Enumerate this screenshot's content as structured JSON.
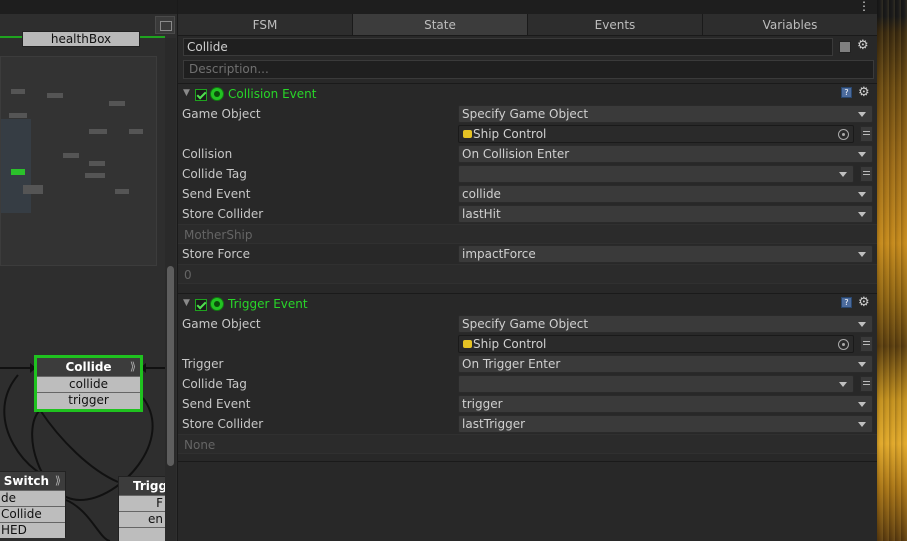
{
  "graph": {
    "nodes": {
      "healthbox": {
        "title": "healthBox"
      },
      "collide": {
        "title": "Collide",
        "events": [
          "collide",
          "trigger"
        ]
      },
      "switch": {
        "title": "g Switch",
        "events": [
          "de",
          "Collide",
          "HED"
        ]
      },
      "trigg": {
        "title": "Trigg",
        "events": [
          "F",
          "en"
        ]
      }
    }
  },
  "inspector": {
    "tabs": [
      "FSM",
      "State",
      "Events",
      "Variables"
    ],
    "active_tab": "State",
    "state_name": "Collide",
    "description_placeholder": "Description...",
    "actions": [
      {
        "title": "Collision Event",
        "rows": {
          "game_object_label": "Game Object",
          "game_object_value": "Specify Game Object",
          "object_field": "Ship Control",
          "collision_label": "Collision",
          "collision_value": "On Collision Enter",
          "collide_tag_label": "Collide Tag",
          "collide_tag_value": "",
          "send_event_label": "Send Event",
          "send_event_value": "collide",
          "store_collider_label": "Store Collider",
          "store_collider_value": "lastHit",
          "disabled_1": "MotherShip",
          "store_force_label": "Store Force",
          "store_force_value": "impactForce",
          "disabled_2": "0"
        }
      },
      {
        "title": "Trigger Event",
        "rows": {
          "game_object_label": "Game Object",
          "game_object_value": "Specify Game Object",
          "object_field": "Ship Control",
          "trigger_label": "Trigger",
          "trigger_value": "On Trigger Enter",
          "collide_tag_label": "Collide Tag",
          "collide_tag_value": "",
          "send_event_label": "Send Event",
          "send_event_value": "trigger",
          "store_collider_label": "Store Collider",
          "store_collider_value": "lastTrigger",
          "disabled_1": "None"
        }
      }
    ]
  },
  "icons": {
    "kebab": "⋮",
    "gear": "⚙",
    "help": "?",
    "collapse": "▼",
    "node_arrow": "⟫"
  },
  "colors": {
    "accent_green": "#28d528",
    "selected_node_border": "#1fc21f",
    "panel_bg": "#282828"
  }
}
